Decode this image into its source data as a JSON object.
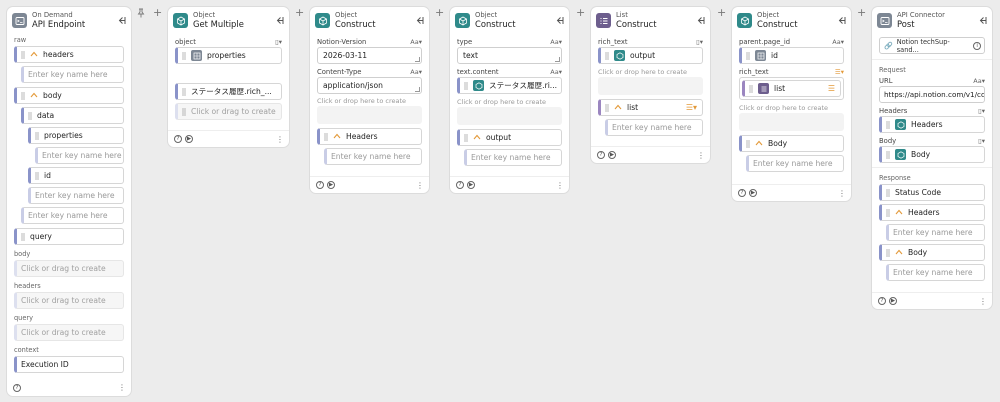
{
  "nodes": {
    "api_endpoint": {
      "category": "On Demand",
      "title": "API Endpoint",
      "raw_label": "raw",
      "headers_label": "headers",
      "body_label": "body",
      "data_label": "data",
      "properties_label": "properties",
      "id_label": "id",
      "query_label": "query",
      "key_placeholder": "Enter key name here",
      "body_section": "body",
      "headers_section": "headers",
      "query_section": "query",
      "context_section": "context",
      "create_hint": "Click or drag to create",
      "execution_id": "Execution ID"
    },
    "get_multiple": {
      "category": "Object",
      "title": "Get Multiple",
      "object_label": "object",
      "properties": "properties",
      "status_value": "ステータス履歴.rich_...",
      "create_hint": "Click or drag to create"
    },
    "construct1": {
      "category": "Object",
      "title": "Construct",
      "notion_version_label": "Notion-Version",
      "notion_version_value": "2026-03-11",
      "content_type_label": "Content-Type",
      "content_type_value": "application/json",
      "drop_hint": "Click or drop here to create",
      "headers_label": "Headers",
      "key_placeholder": "Enter key name here"
    },
    "construct2": {
      "category": "Object",
      "title": "Construct",
      "type_label": "type",
      "type_value": "text",
      "text_content_label": "text.content",
      "text_content_value": "ステータス履歴.ri...",
      "drop_hint": "Click or drop here to create",
      "output_label": "output",
      "key_placeholder": "Enter key name here"
    },
    "list_construct": {
      "category": "List",
      "title": "Construct",
      "rich_text_label": "rich_text",
      "output": "output",
      "drop_hint": "Click or drop here to create",
      "list_label": "list",
      "key_placeholder": "Enter key name here"
    },
    "construct3": {
      "category": "Object",
      "title": "Construct",
      "parent_label": "parent.page_id",
      "id_value": "id",
      "rich_text_label": "rich_text",
      "list_value": "list",
      "drop_hint": "Click or drop here to create",
      "body_label": "Body",
      "key_placeholder": "Enter key name here"
    },
    "api_connector": {
      "category": "API Connector",
      "title": "Post",
      "connection": "Notion techSup-sand...",
      "request_section": "Request",
      "url_label": "URL",
      "url_value": "https://api.notion.com/v1/co",
      "headers_label": "Headers",
      "headers_value": "Headers",
      "body_label": "Body",
      "body_value": "Body",
      "response_section": "Response",
      "status_code": "Status Code",
      "resp_headers": "Headers",
      "resp_body": "Body",
      "key_placeholder": "Enter key name here"
    }
  },
  "type_badge": "Aa",
  "icons": {
    "collapse": "collapse-left-icon",
    "add": "plus-icon",
    "pin": "pin-icon",
    "help": "help-icon",
    "play": "play-icon",
    "more": "more-icon"
  },
  "colors": {
    "teal": "#2f8a8a",
    "gray": "#7d8794",
    "purple": "#6d5e8d",
    "accent_orange": "#e39a3a",
    "port_blue": "#8a93c9"
  }
}
